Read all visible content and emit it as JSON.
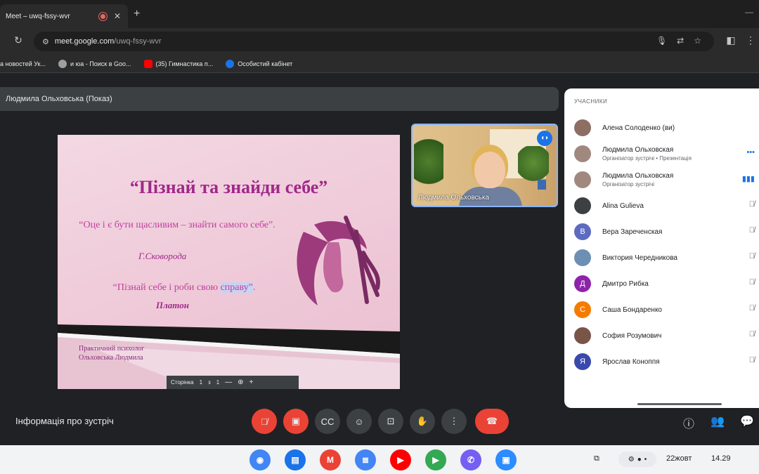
{
  "browser": {
    "tab_title": "Meet – uwq-fssy-wvr",
    "tab_close": "✕",
    "new_tab": "+",
    "url_host": "meet.google.com",
    "url_path": "/uwq-fssy-wvr",
    "bookmarks": [
      {
        "label": "а новостей Ук...",
        "color": "#c0c4c8"
      },
      {
        "label": "и юа - Поиск в Goo...",
        "color": "#9aa0a6"
      },
      {
        "label": "(35) Гимнастика п...",
        "color": "#ff0000"
      },
      {
        "label": "Особистий кабінет",
        "color": "#1a73e8"
      }
    ]
  },
  "meet": {
    "presenter_label": "Людмила Ольховська (Показ)",
    "meeting_info": "Інформація про зустріч",
    "self_view_name": "Людмила Ольховська"
  },
  "slide": {
    "title": "“Пізнай та знайди себе”",
    "quote1": "“Оце і є бути щасливим – знайти самого себе”.",
    "author1": "Г.Сковорода",
    "quote2_pre": "“Пізнай себе  і роби свою ",
    "quote2_hl": "справу”",
    "quote2_post": ".",
    "author2": "Платон",
    "signature_line1": "Практичний психолог",
    "signature_line2": "Ольховська Людмила",
    "pdf_page_label": "Сторінка",
    "pdf_page_num": "1",
    "pdf_sep": "з",
    "pdf_total": "1"
  },
  "panel": {
    "header": "УЧАСНИКИ",
    "participants": [
      {
        "name": "Алена Солоденко (ви)",
        "role": "",
        "initial": "",
        "color": "#8d6e63",
        "right": ""
      },
      {
        "name": "Людмила Ольховская",
        "role": "Організатор зустрічі • Презентація",
        "initial": "",
        "color": "#a1887f",
        "right": "•••"
      },
      {
        "name": "Людмила Ольховская",
        "role": "Організатор зустрічі",
        "initial": "",
        "color": "#a1887f",
        "right": "▮▮▮"
      },
      {
        "name": "Alina Gulieva",
        "role": "",
        "initial": "",
        "color": "#3c4043",
        "right": "🎙̸"
      },
      {
        "name": "Вера Зареченская",
        "role": "",
        "initial": "В",
        "color": "#5c6bc0",
        "right": "🎙̸"
      },
      {
        "name": "Виктория Чередникова",
        "role": "",
        "initial": "",
        "color": "#6d8fb3",
        "right": "🎙̸"
      },
      {
        "name": "Дмитро Рибка",
        "role": "",
        "initial": "Д",
        "color": "#8e24aa",
        "right": "🎙̸"
      },
      {
        "name": "Саша Бондаренко",
        "role": "",
        "initial": "С",
        "color": "#f57c00",
        "right": "🎙̸"
      },
      {
        "name": "София Розумович",
        "role": "",
        "initial": "",
        "color": "#795548",
        "right": "🎙̸"
      },
      {
        "name": "Ярослав Коноппя",
        "role": "",
        "initial": "Я",
        "color": "#3949ab",
        "right": "🎙̸"
      }
    ]
  },
  "shelf": {
    "date": "22жовт",
    "time": "14.29",
    "apps": [
      {
        "name": "chrome",
        "glyph": "◉",
        "color": "#4285f4"
      },
      {
        "name": "files",
        "glyph": "▤",
        "color": "#1a73e8"
      },
      {
        "name": "gmail",
        "glyph": "M",
        "color": "#ea4335"
      },
      {
        "name": "docs",
        "glyph": "≣",
        "color": "#4285f4"
      },
      {
        "name": "youtube",
        "glyph": "▶",
        "color": "#ff0000"
      },
      {
        "name": "play-store",
        "glyph": "▶",
        "color": "#34a853"
      },
      {
        "name": "viber",
        "glyph": "✆",
        "color": "#7360f2"
      },
      {
        "name": "zoom",
        "glyph": "▣",
        "color": "#2d8cff"
      }
    ]
  }
}
